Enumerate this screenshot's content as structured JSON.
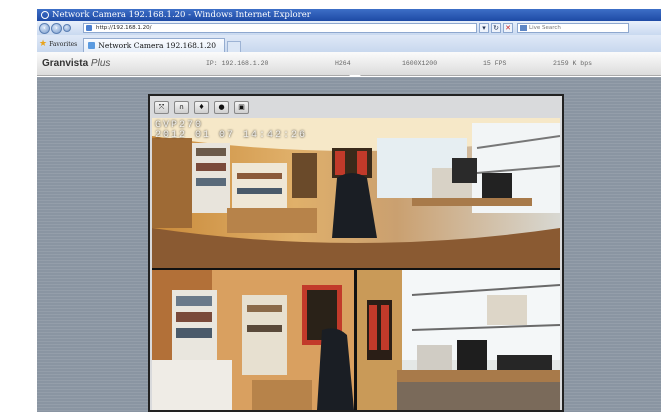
{
  "browser": {
    "window_title": "Network Camera 192.168.1.20 - Windows Internet Explorer",
    "address": "http://192.168.1.20/",
    "search_placeholder": "Live Search",
    "favorites_label": "Favorites",
    "tab_title": "Network Camera 192.168.1.20"
  },
  "header": {
    "brand": "Granvista",
    "brand_suffix": "Plus",
    "ip": "IP: 192.168.1.20",
    "codec": "H264",
    "resolution": "1600X1200",
    "fps": "15 FPS",
    "bitrate": "2159 K bps"
  },
  "viewer": {
    "tools": [
      {
        "name": "fullscreen-icon",
        "glyph": "⤧"
      },
      {
        "name": "headphones-icon",
        "glyph": "∩"
      },
      {
        "name": "microphone-icon",
        "glyph": "♦"
      },
      {
        "name": "record-icon",
        "glyph": "●"
      },
      {
        "name": "snapshot-icon",
        "glyph": "▣"
      }
    ],
    "overlay_model": "GVP270",
    "overlay_timestamp": "2012 01 07 14:42:26"
  },
  "colors": {
    "ie_titlebar": "#2557b4",
    "page_background": "#8a95a2",
    "viewer_frame": "#222222"
  }
}
